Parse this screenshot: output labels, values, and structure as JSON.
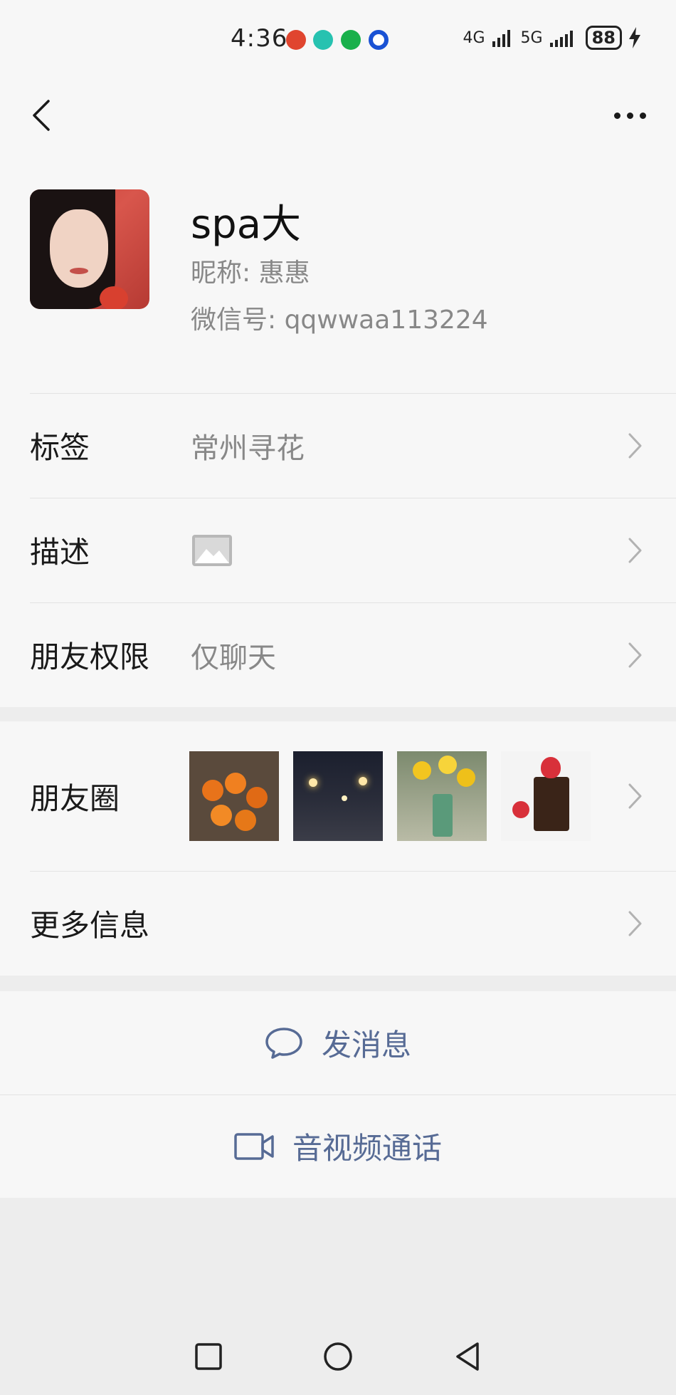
{
  "status_bar": {
    "time": "4:36",
    "signal_1": "4G",
    "signal_2": "5G",
    "battery": "88"
  },
  "profile": {
    "name": "spa大",
    "nickname": "昵称:  惠惠",
    "wechat_id": "微信号:  qqwwaa113224"
  },
  "info_cells": [
    {
      "label": "标签",
      "value": "常州寻花"
    },
    {
      "label": "描述",
      "value": "",
      "icon": "image-icon"
    },
    {
      "label": "朋友权限",
      "value": "仅聊天"
    }
  ],
  "moments": {
    "label": "朋友圈",
    "thumbnails": [
      "tomatoes-photo",
      "night-street-photo",
      "daffodils-photo",
      "chocolate-strawberry-photo"
    ]
  },
  "more_info": {
    "label": "更多信息"
  },
  "actions": {
    "send_message": "发消息",
    "video_call": "音视频通话"
  },
  "colors": {
    "link_blue": "#576b95",
    "background": "#ededed",
    "cell_bg": "#f7f7f7"
  }
}
